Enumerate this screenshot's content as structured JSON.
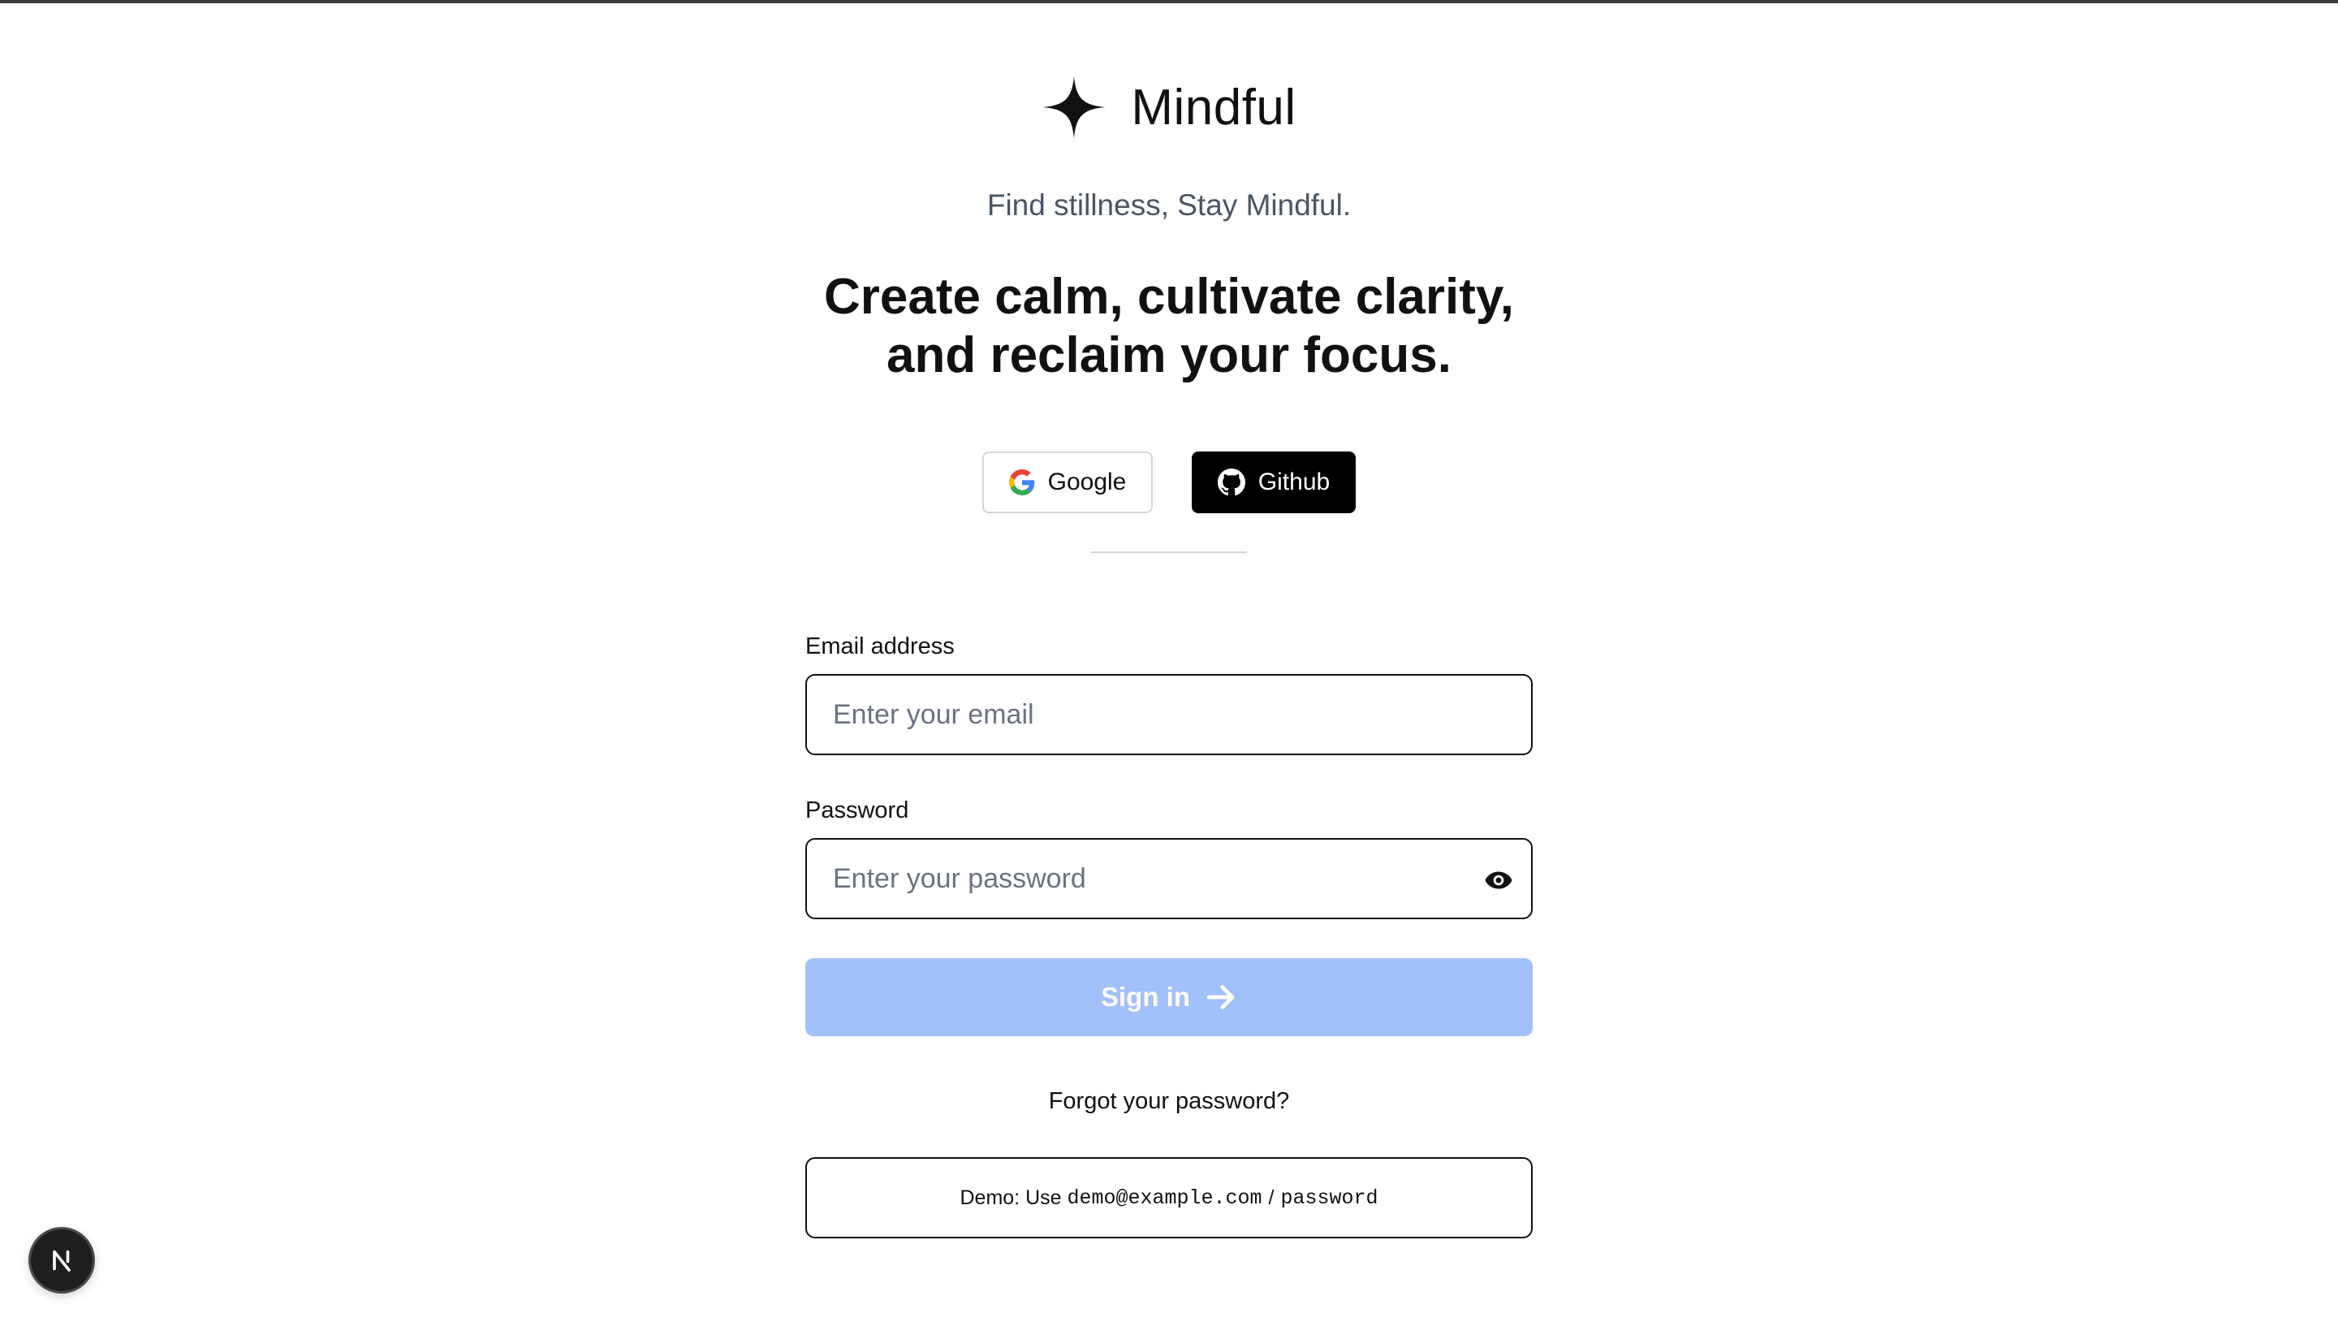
{
  "brand": {
    "name": "Mindful",
    "tagline": "Find stillness, Stay Mindful."
  },
  "headline": {
    "line1": "Create calm, cultivate clarity,",
    "line2": "and reclaim your focus."
  },
  "social": {
    "google_label": "Google",
    "github_label": "Github"
  },
  "form": {
    "email_label": "Email address",
    "email_placeholder": "Enter your email",
    "password_label": "Password",
    "password_placeholder": "Enter your password",
    "signin_label": "Sign in",
    "forgot_label": "Forgot your password?"
  },
  "demo": {
    "prefix": "Demo: Use ",
    "email": "demo@example.com",
    "separator": "/",
    "password": "password"
  },
  "colors": {
    "signin_bg": "#a2c0fa",
    "github_bg": "#000000",
    "tagline": "#4b5563"
  },
  "icons": {
    "brand": "sparkle-icon",
    "google": "google-icon",
    "github": "github-icon",
    "password_toggle": "eye-icon",
    "signin": "arrow-right-icon",
    "dev_badge": "nextjs-icon"
  }
}
